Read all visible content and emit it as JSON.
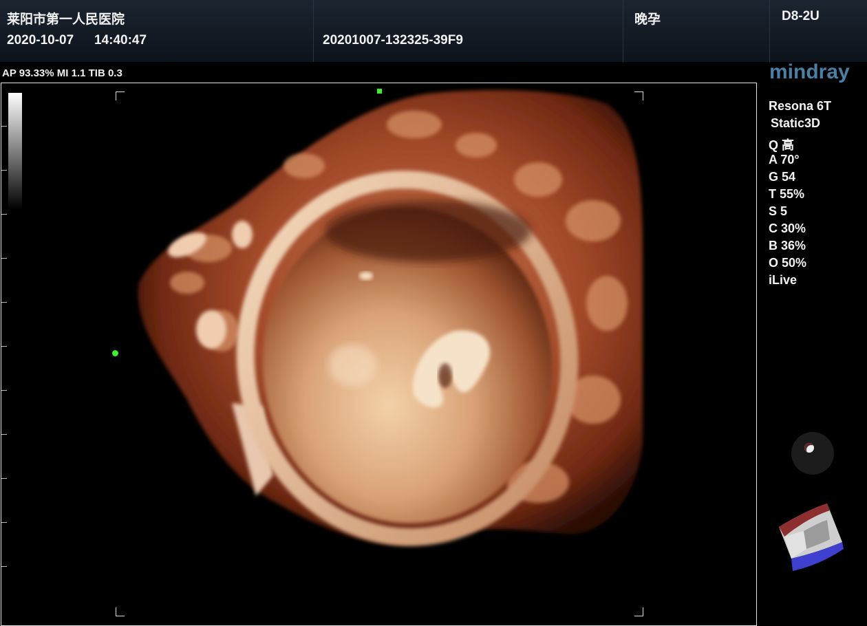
{
  "header": {
    "hospital": "莱阳市第一人民医院",
    "date": "2020-10-07",
    "time": "14:40:47",
    "exam_id": "20201007-132325-39F9",
    "exam_type": "晚孕",
    "probe": "D8-2U"
  },
  "status": "AP 93.33%  MI 1.1 TIB 0.3",
  "brand": "mindray",
  "device": {
    "model": "Resona 6T",
    "mode": "Static3D",
    "params": [
      "Q 高",
      "A 70°",
      "G 54",
      "T 55%",
      "S 5",
      "C 30%",
      "B 36%",
      "O 50%",
      "iLive"
    ]
  },
  "colors": {
    "marker": "#3cf02d",
    "brand": "#4a7fa6",
    "tissue_light": "#f1d3b0",
    "tissue_dark": "#7a2e14"
  },
  "icons": {
    "orientation_knob": "circle-knob-icon",
    "orientation_cube": "3d-orientation-cube-icon"
  }
}
